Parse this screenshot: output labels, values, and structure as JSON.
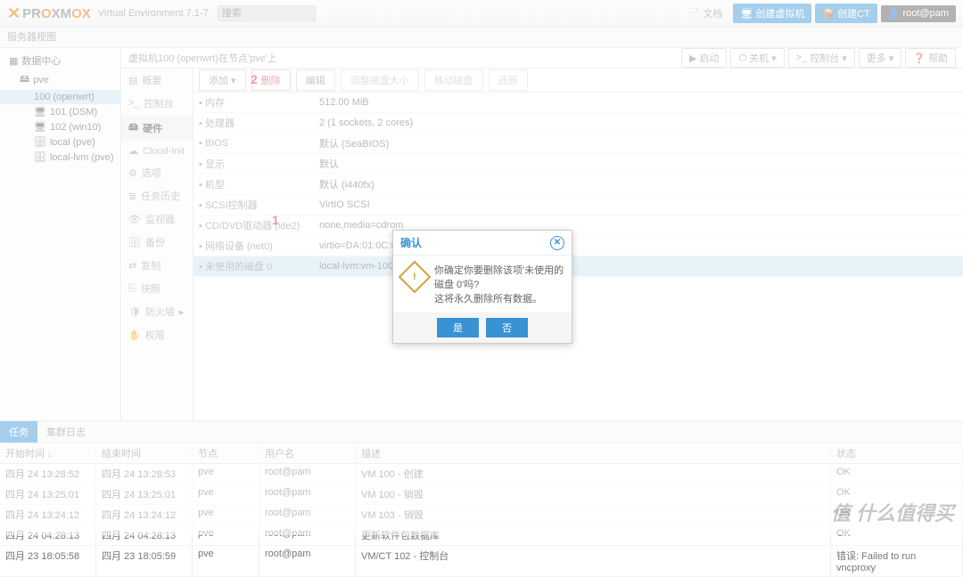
{
  "header": {
    "brand_pre": "PR",
    "brand_o": "O",
    "brand_post": "XM",
    "brand_ox": "OX",
    "version": "Virtual Environment 7.1-7",
    "search_ph": "搜索",
    "doc": "文档",
    "createVM": "创建虚拟机",
    "createCT": "创建CT",
    "user": "root@pam"
  },
  "toolbar2": "服务器视图",
  "tree": {
    "dc": "数据中心",
    "pve": "pve",
    "n100": "100 (openwrt)",
    "n101": "101 (DSM)",
    "n102": "102 (win10)",
    "local": "local (pve)",
    "lvm": "local-lvm (pve)"
  },
  "breadcrumb": "虚拟机100 (openwrt)在节点'pve'上",
  "crumbBtns": {
    "start": "启动",
    "shutdown": "关机",
    "console": "控制台",
    "more": "更多",
    "help": "帮助"
  },
  "sidenav": [
    "概要",
    "控制台",
    "硬件",
    "Cloud-Init",
    "选项",
    "任务历史",
    "监视器",
    "备份",
    "复制",
    "快照",
    "防火墙",
    "权限"
  ],
  "tbar": {
    "add": "添加",
    "remove": "删除",
    "edit": "编辑",
    "resize": "调整磁盘大小",
    "move": "移动磁盘",
    "revert": "还原"
  },
  "hw": [
    {
      "k": "内存",
      "v": "512.00 MiB"
    },
    {
      "k": "处理器",
      "v": "2 (1 sockets, 2 cores)"
    },
    {
      "k": "BIOS",
      "v": "默认 (SeaBIOS)"
    },
    {
      "k": "显示",
      "v": "默认"
    },
    {
      "k": "机型",
      "v": "默认 (i440fx)"
    },
    {
      "k": "SCSI控制器",
      "v": "VirtIO SCSI"
    },
    {
      "k": "CD/DVD驱动器 (ide2)",
      "v": "none,media=cdrom"
    },
    {
      "k": "网络设备 (net0)",
      "v": "virtio=DA:01:0C:63:82:71,bridge=vmbr0,firewall=1"
    },
    {
      "k": "未使用的磁盘 0",
      "v": "local-lvm:vm-100-disk-0"
    }
  ],
  "annot": {
    "one": "1",
    "two": "2"
  },
  "modal": {
    "title": "确认",
    "msg1": "你确定你要删除该项'未使用的磁盘 0'吗?",
    "msg2": "这将永久删除所有数据。",
    "yes": "是",
    "no": "否"
  },
  "tabs": {
    "tasks": "任务",
    "cluster": "集群日志"
  },
  "loghead": {
    "start": "开始时间 ↓",
    "end": "结束时间",
    "node": "节点",
    "user": "用户名",
    "desc": "描述",
    "status": "状态"
  },
  "logs": [
    {
      "s": "四月 24 13:28:52",
      "e": "四月 24 13:28:53",
      "n": "pve",
      "u": "root@pam",
      "d": "VM 100 - 创建",
      "st": "OK"
    },
    {
      "s": "四月 24 13:25:01",
      "e": "四月 24 13:25:01",
      "n": "pve",
      "u": "root@pam",
      "d": "VM 100 - 销毁",
      "st": "OK"
    },
    {
      "s": "四月 24 13:24:12",
      "e": "四月 24 13:24:12",
      "n": "pve",
      "u": "root@pam",
      "d": "VM 103 - 销毁",
      "st": "OK"
    },
    {
      "s": "四月 24 04:28:13",
      "e": "四月 24 04:28:13",
      "n": "pve",
      "u": "root@pam",
      "d": "更新软件包数据库",
      "st": "OK"
    },
    {
      "s": "四月 23 18:05:58",
      "e": "四月 23 18:05:59",
      "n": "pve",
      "u": "root@pam",
      "d": "VM/CT 102 - 控制台",
      "st": "错误: Failed to run vncproxy"
    }
  ],
  "watermark": "值  什么值得买"
}
